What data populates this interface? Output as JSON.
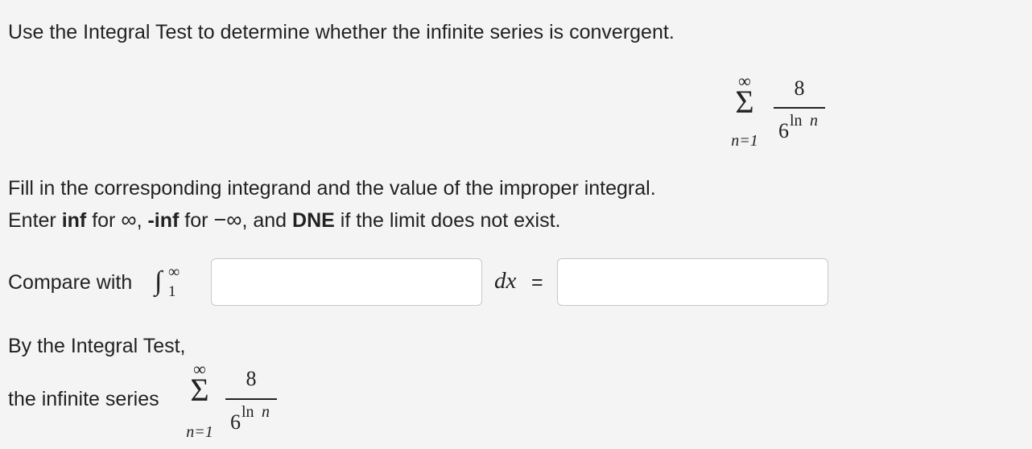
{
  "question": {
    "intro": "Use the Integral Test to determine whether the infinite series is convergent."
  },
  "series": {
    "upper": "∞",
    "sigma": "Σ",
    "lower": "n=1",
    "numerator": "8",
    "den_base": "6",
    "den_exp_fn": "ln",
    "den_exp_var": "n"
  },
  "instructions": {
    "line1": "Fill in the corresponding integrand and the value of the improper integral.",
    "line2_enter": "Enter ",
    "line2_inf": "inf",
    "line2_for1": " for ",
    "line2_sym1": "∞",
    "line2_comma1": ", ",
    "line2_neginf": "-inf",
    "line2_for2": " for ",
    "line2_sym2": "−∞",
    "line2_and": ", and ",
    "line2_dne": "DNE",
    "line2_tail": " if the limit does not exist."
  },
  "compare": {
    "label": "Compare with",
    "integral_sign": "∫",
    "upper": "∞",
    "lower": "1",
    "dx": "dx",
    "equals": "=",
    "integrand_value": "",
    "result_value": ""
  },
  "conclusion": {
    "heading": "By the Integral Test,",
    "series_label": "the infinite series"
  }
}
